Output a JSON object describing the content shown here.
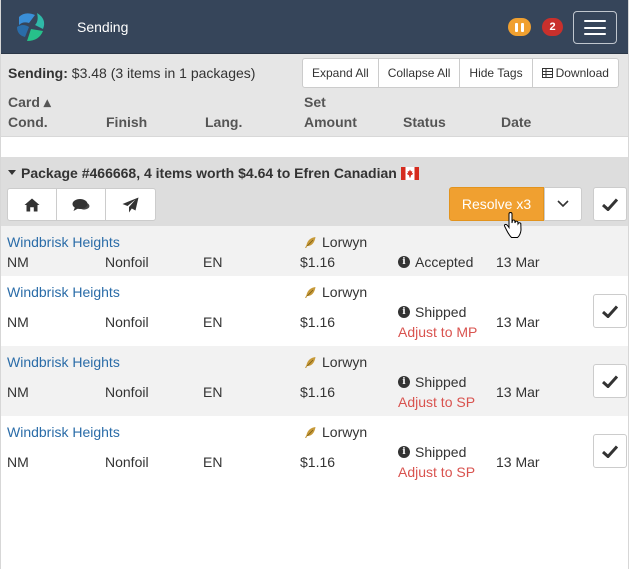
{
  "navbar": {
    "title": "Sending",
    "notification_count": "2",
    "colors": {
      "bar": "#36455a",
      "pause_badge": "#f0a030",
      "count_badge": "#c9302c"
    }
  },
  "summary": {
    "label": "Sending:",
    "value": "$3.48 (3 items in 1 packages)",
    "buttons": {
      "expand_all": "Expand All",
      "collapse_all": "Collapse All",
      "hide_tags": "Hide Tags",
      "download": "Download"
    }
  },
  "columns": {
    "card": "Card ▴",
    "cond": "Cond.",
    "finish": "Finish",
    "lang": "Lang.",
    "set": "Set",
    "amount": "Amount",
    "status": "Status",
    "date": "Date"
  },
  "package": {
    "title": "Package #466668, 4 items worth $4.64 to Efren Canadian",
    "flag_icon": "canada-flag-icon",
    "icons": [
      "home-icon",
      "comments-icon",
      "paper-plane-icon"
    ],
    "resolve_label": "Resolve x3",
    "accent_color": "#f0a030",
    "items": [
      {
        "card": "Windbrisk Heights",
        "set": "Lorwyn",
        "cond": "NM",
        "finish": "Nonfoil",
        "lang": "EN",
        "amount": "$1.16",
        "status": "Accepted",
        "adjust": "",
        "date": "13 Mar"
      },
      {
        "card": "Windbrisk Heights",
        "set": "Lorwyn",
        "cond": "NM",
        "finish": "Nonfoil",
        "lang": "EN",
        "amount": "$1.16",
        "status": "Shipped",
        "adjust": "Adjust to MP",
        "date": "13 Mar"
      },
      {
        "card": "Windbrisk Heights",
        "set": "Lorwyn",
        "cond": "NM",
        "finish": "Nonfoil",
        "lang": "EN",
        "amount": "$1.16",
        "status": "Shipped",
        "adjust": "Adjust to SP",
        "date": "13 Mar"
      },
      {
        "card": "Windbrisk Heights",
        "set": "Lorwyn",
        "cond": "NM",
        "finish": "Nonfoil",
        "lang": "EN",
        "amount": "$1.16",
        "status": "Shipped",
        "adjust": "Adjust to SP",
        "date": "13 Mar"
      }
    ]
  }
}
